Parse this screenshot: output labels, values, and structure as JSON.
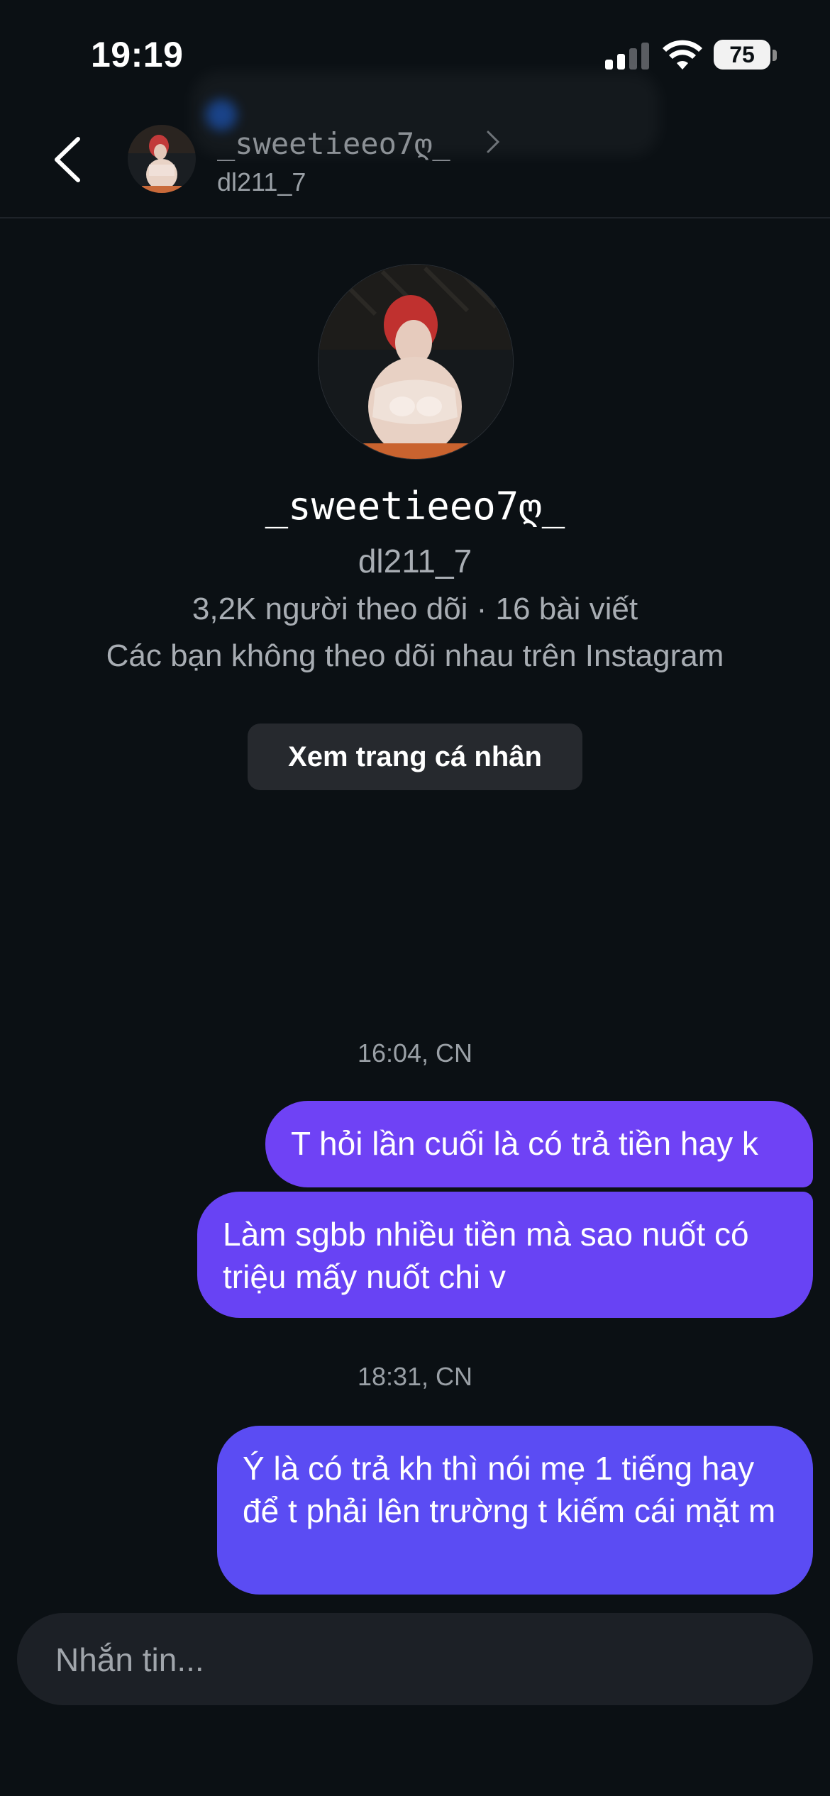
{
  "status_bar": {
    "time": "19:19",
    "battery": "75"
  },
  "header": {
    "name": "_sweetieeo7ღ_",
    "username": "dl211_7",
    "back_icon": "chevron-left-icon",
    "profile_chevron_icon": "chevron-right-icon"
  },
  "profile": {
    "name": "_sweetieeo7ღ_",
    "username": "dl211_7",
    "stats": "3,2K người theo dõi · 16 bài viết",
    "follow_note": "Các bạn không theo dõi nhau trên Instagram",
    "view_profile_label": "Xem trang cá nhân"
  },
  "messages": [
    {
      "timestamp": "16:04, CN"
    },
    {
      "text": "T hỏi lần cuối là có trả tiền hay k"
    },
    {
      "text": "Làm sgbb nhiều tiền mà sao nuốt có triệu mấy nuốt chi v"
    },
    {
      "timestamp": "18:31, CN"
    },
    {
      "text": "Ý là có trả kh thì nói mẹ 1 tiếng hay để t phải lên trường t kiếm cái mặt m"
    }
  ],
  "composer": {
    "placeholder": "Nhắn tin..."
  },
  "colors": {
    "background": "#0b1014",
    "bubble_top": "#6f42f5",
    "bubble_bottom": "#5b4cf3",
    "button_bg": "#26292e",
    "input_bg": "#1c2026"
  }
}
